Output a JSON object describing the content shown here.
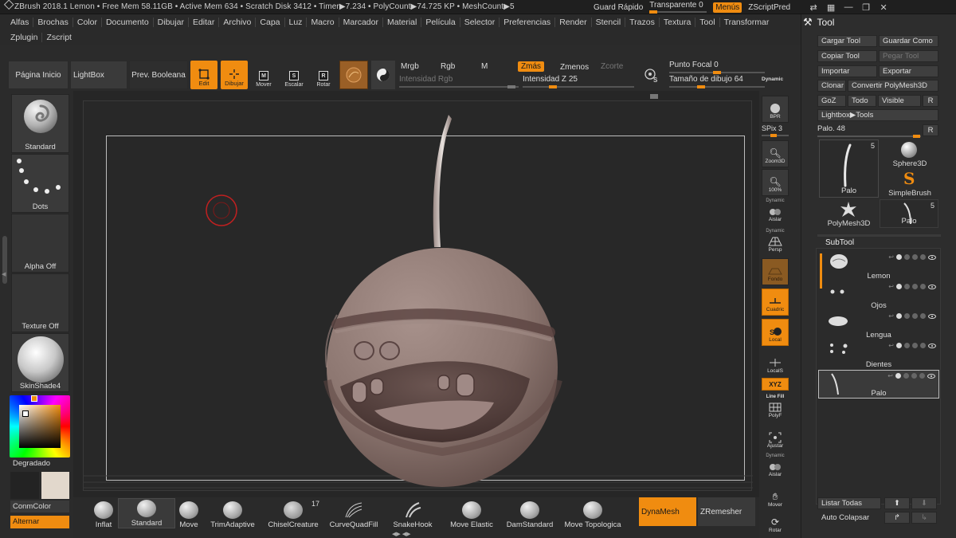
{
  "titlebar": {
    "info": "ZBrush 2018.1    Lemon    • Free Mem 58.11GB • Active Mem 634 • Scratch Disk 3412 •  Timer▶7.234 • PolyCount▶74.725 KP  • MeshCount▶5",
    "quicksave": "Guard Rápido",
    "transparent": "Transparente 0",
    "transparent_value": 0,
    "menus": "Menús",
    "script": "ZScriptPred"
  },
  "menus": {
    "row1": [
      "Alfas",
      "Brochas",
      "Color",
      "Documento",
      "Dibujar",
      "Editar",
      "Archivo",
      "Capa",
      "Luz",
      "Macro",
      "Marcador",
      "Material",
      "Película",
      "Selector",
      "Preferencias",
      "Render",
      "Stencil",
      "Trazos",
      "Textura",
      "Tool",
      "Transformar"
    ],
    "row2": [
      "Zplugin",
      "Zscript"
    ]
  },
  "shelf": {
    "home": "Página Inicio",
    "lightbox": "LightBox",
    "boolean": "Prev. Booleana",
    "edit": "Edit",
    "draw": "Dibujar",
    "move": "Mover",
    "scale": "Escalar",
    "rotate": "Rotar",
    "mrgb": "Mrgb",
    "rgb": "Rgb",
    "m": "M",
    "zadd": "Zmás",
    "zsub": "Zmenos",
    "zcut": "Zcorte",
    "rgb_intensity": "Intensidad Rgb",
    "z_intensity": "Intensidad Z 25",
    "z_intensity_value": 25,
    "focal": "Punto Focal 0",
    "focal_value": 0,
    "draw_size": "Tamaño de dibujo 64",
    "draw_size_value": 64,
    "dynamic": "Dynamic"
  },
  "leftpal": {
    "brush": "Standard",
    "stroke": "Dots",
    "alpha": "Alpha Off",
    "texture": "Texture Off",
    "material": "SkinShade4",
    "gradient": "Degradado",
    "switch_color": "ConmColor",
    "alternate": "Alternar"
  },
  "rstrip": {
    "bpr": "BPR",
    "spix": "SPix 3",
    "zoom3d": "Zoom3D",
    "actual": "100%",
    "aislar": "Aislar",
    "persp": "Persp",
    "floor": "Fondo",
    "grid": "Cuadric",
    "local": "Local",
    "locals": "LocalS",
    "xyz": "XYZ",
    "linefill": "Line Fill",
    "polyf": "PolyF",
    "ajustar": "Ajustar",
    "aislar2": "Aislar",
    "mover": "Mover",
    "rotar": "Rotar",
    "dynamic": "Dynamic"
  },
  "brushes": [
    {
      "label": "Inflat"
    },
    {
      "label": "Standard"
    },
    {
      "label": "Move"
    },
    {
      "label": "TrimAdaptive"
    },
    {
      "label": "ChiselCreature",
      "count": "17"
    },
    {
      "label": "CurveQuadFill"
    },
    {
      "label": "SnakeHook"
    },
    {
      "label": "Move Elastic"
    },
    {
      "label": "DamStandard"
    },
    {
      "label": "Move Topologica"
    }
  ],
  "bottom": {
    "dynamesh": "DynaMesh",
    "zremesher": "ZRemesher"
  },
  "tool": {
    "title": "Tool",
    "load": "Cargar Tool",
    "save": "Guardar Como",
    "copy": "Copiar Tool",
    "paste": "Pegar Tool",
    "import": "Importar",
    "export": "Exportar",
    "clone": "Clonar",
    "convert": "Convertir PolyMesh3D",
    "goz": "GoZ",
    "all": "Todo",
    "visible": "Visible",
    "r": "R",
    "lightbox_tools": "Lightbox▶Tools",
    "palo_slider": "Palo. 48",
    "palo_value": 48,
    "thumbs": [
      {
        "label": "Palo",
        "count": "5"
      },
      {
        "label": "Sphere3D"
      },
      {
        "label": "SimpleBrush"
      },
      {
        "label": "PolyMesh3D"
      },
      {
        "label": "Palo",
        "count": "5"
      }
    ],
    "subtool_title": "SubTool",
    "subtools": [
      "Lemon",
      "Ojos",
      "Lengua",
      "Dientes",
      "Palo"
    ],
    "list_all": "Listar Todas",
    "auto_collapse": "Auto Colapsar"
  }
}
